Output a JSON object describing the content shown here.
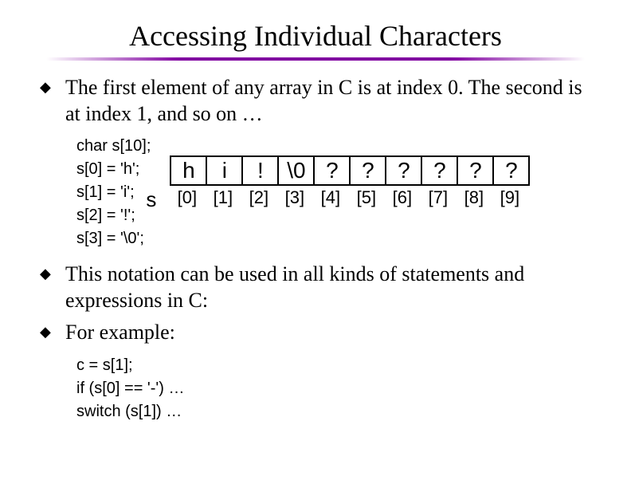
{
  "title": "Accessing Individual Characters",
  "bullets": {
    "b1": "The first element of any array in C is at index 0.  The second is at index 1, and so on …",
    "b2": "This notation can be used in all kinds of statements and expressions in C:",
    "b3": "For example:"
  },
  "code1": {
    "l1": "char s[10];",
    "l2": "s[0] = 'h';",
    "l3": "s[1] = 'i';",
    "l4": "s[2] = '!';",
    "l5": "s[3] = '\\0';"
  },
  "array": {
    "label": "s",
    "cells": [
      "h",
      "i",
      "!",
      "\\0",
      "?",
      "?",
      "?",
      "?",
      "?",
      "?"
    ],
    "indices": [
      "[0]",
      "[1]",
      "[2]",
      "[3]",
      "[4]",
      "[5]",
      "[6]",
      "[7]",
      "[8]",
      "[9]"
    ]
  },
  "code2": {
    "l1": "c = s[1];",
    "l2": "if (s[0] == '-') …",
    "l3": "switch (s[1]) …"
  }
}
